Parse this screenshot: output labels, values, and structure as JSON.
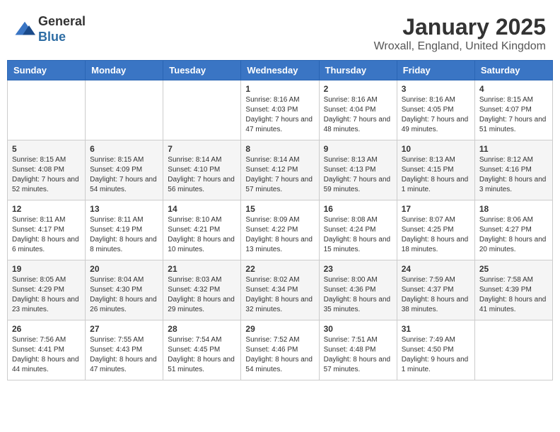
{
  "logo": {
    "general": "General",
    "blue": "Blue"
  },
  "title": "January 2025",
  "location": "Wroxall, England, United Kingdom",
  "days_of_week": [
    "Sunday",
    "Monday",
    "Tuesday",
    "Wednesday",
    "Thursday",
    "Friday",
    "Saturday"
  ],
  "weeks": [
    [
      {
        "day": "",
        "info": ""
      },
      {
        "day": "",
        "info": ""
      },
      {
        "day": "",
        "info": ""
      },
      {
        "day": "1",
        "info": "Sunrise: 8:16 AM\nSunset: 4:03 PM\nDaylight: 7 hours and 47 minutes."
      },
      {
        "day": "2",
        "info": "Sunrise: 8:16 AM\nSunset: 4:04 PM\nDaylight: 7 hours and 48 minutes."
      },
      {
        "day": "3",
        "info": "Sunrise: 8:16 AM\nSunset: 4:05 PM\nDaylight: 7 hours and 49 minutes."
      },
      {
        "day": "4",
        "info": "Sunrise: 8:15 AM\nSunset: 4:07 PM\nDaylight: 7 hours and 51 minutes."
      }
    ],
    [
      {
        "day": "5",
        "info": "Sunrise: 8:15 AM\nSunset: 4:08 PM\nDaylight: 7 hours and 52 minutes."
      },
      {
        "day": "6",
        "info": "Sunrise: 8:15 AM\nSunset: 4:09 PM\nDaylight: 7 hours and 54 minutes."
      },
      {
        "day": "7",
        "info": "Sunrise: 8:14 AM\nSunset: 4:10 PM\nDaylight: 7 hours and 56 minutes."
      },
      {
        "day": "8",
        "info": "Sunrise: 8:14 AM\nSunset: 4:12 PM\nDaylight: 7 hours and 57 minutes."
      },
      {
        "day": "9",
        "info": "Sunrise: 8:13 AM\nSunset: 4:13 PM\nDaylight: 7 hours and 59 minutes."
      },
      {
        "day": "10",
        "info": "Sunrise: 8:13 AM\nSunset: 4:15 PM\nDaylight: 8 hours and 1 minute."
      },
      {
        "day": "11",
        "info": "Sunrise: 8:12 AM\nSunset: 4:16 PM\nDaylight: 8 hours and 3 minutes."
      }
    ],
    [
      {
        "day": "12",
        "info": "Sunrise: 8:11 AM\nSunset: 4:17 PM\nDaylight: 8 hours and 6 minutes."
      },
      {
        "day": "13",
        "info": "Sunrise: 8:11 AM\nSunset: 4:19 PM\nDaylight: 8 hours and 8 minutes."
      },
      {
        "day": "14",
        "info": "Sunrise: 8:10 AM\nSunset: 4:21 PM\nDaylight: 8 hours and 10 minutes."
      },
      {
        "day": "15",
        "info": "Sunrise: 8:09 AM\nSunset: 4:22 PM\nDaylight: 8 hours and 13 minutes."
      },
      {
        "day": "16",
        "info": "Sunrise: 8:08 AM\nSunset: 4:24 PM\nDaylight: 8 hours and 15 minutes."
      },
      {
        "day": "17",
        "info": "Sunrise: 8:07 AM\nSunset: 4:25 PM\nDaylight: 8 hours and 18 minutes."
      },
      {
        "day": "18",
        "info": "Sunrise: 8:06 AM\nSunset: 4:27 PM\nDaylight: 8 hours and 20 minutes."
      }
    ],
    [
      {
        "day": "19",
        "info": "Sunrise: 8:05 AM\nSunset: 4:29 PM\nDaylight: 8 hours and 23 minutes."
      },
      {
        "day": "20",
        "info": "Sunrise: 8:04 AM\nSunset: 4:30 PM\nDaylight: 8 hours and 26 minutes."
      },
      {
        "day": "21",
        "info": "Sunrise: 8:03 AM\nSunset: 4:32 PM\nDaylight: 8 hours and 29 minutes."
      },
      {
        "day": "22",
        "info": "Sunrise: 8:02 AM\nSunset: 4:34 PM\nDaylight: 8 hours and 32 minutes."
      },
      {
        "day": "23",
        "info": "Sunrise: 8:00 AM\nSunset: 4:36 PM\nDaylight: 8 hours and 35 minutes."
      },
      {
        "day": "24",
        "info": "Sunrise: 7:59 AM\nSunset: 4:37 PM\nDaylight: 8 hours and 38 minutes."
      },
      {
        "day": "25",
        "info": "Sunrise: 7:58 AM\nSunset: 4:39 PM\nDaylight: 8 hours and 41 minutes."
      }
    ],
    [
      {
        "day": "26",
        "info": "Sunrise: 7:56 AM\nSunset: 4:41 PM\nDaylight: 8 hours and 44 minutes."
      },
      {
        "day": "27",
        "info": "Sunrise: 7:55 AM\nSunset: 4:43 PM\nDaylight: 8 hours and 47 minutes."
      },
      {
        "day": "28",
        "info": "Sunrise: 7:54 AM\nSunset: 4:45 PM\nDaylight: 8 hours and 51 minutes."
      },
      {
        "day": "29",
        "info": "Sunrise: 7:52 AM\nSunset: 4:46 PM\nDaylight: 8 hours and 54 minutes."
      },
      {
        "day": "30",
        "info": "Sunrise: 7:51 AM\nSunset: 4:48 PM\nDaylight: 8 hours and 57 minutes."
      },
      {
        "day": "31",
        "info": "Sunrise: 7:49 AM\nSunset: 4:50 PM\nDaylight: 9 hours and 1 minute."
      },
      {
        "day": "",
        "info": ""
      }
    ]
  ]
}
